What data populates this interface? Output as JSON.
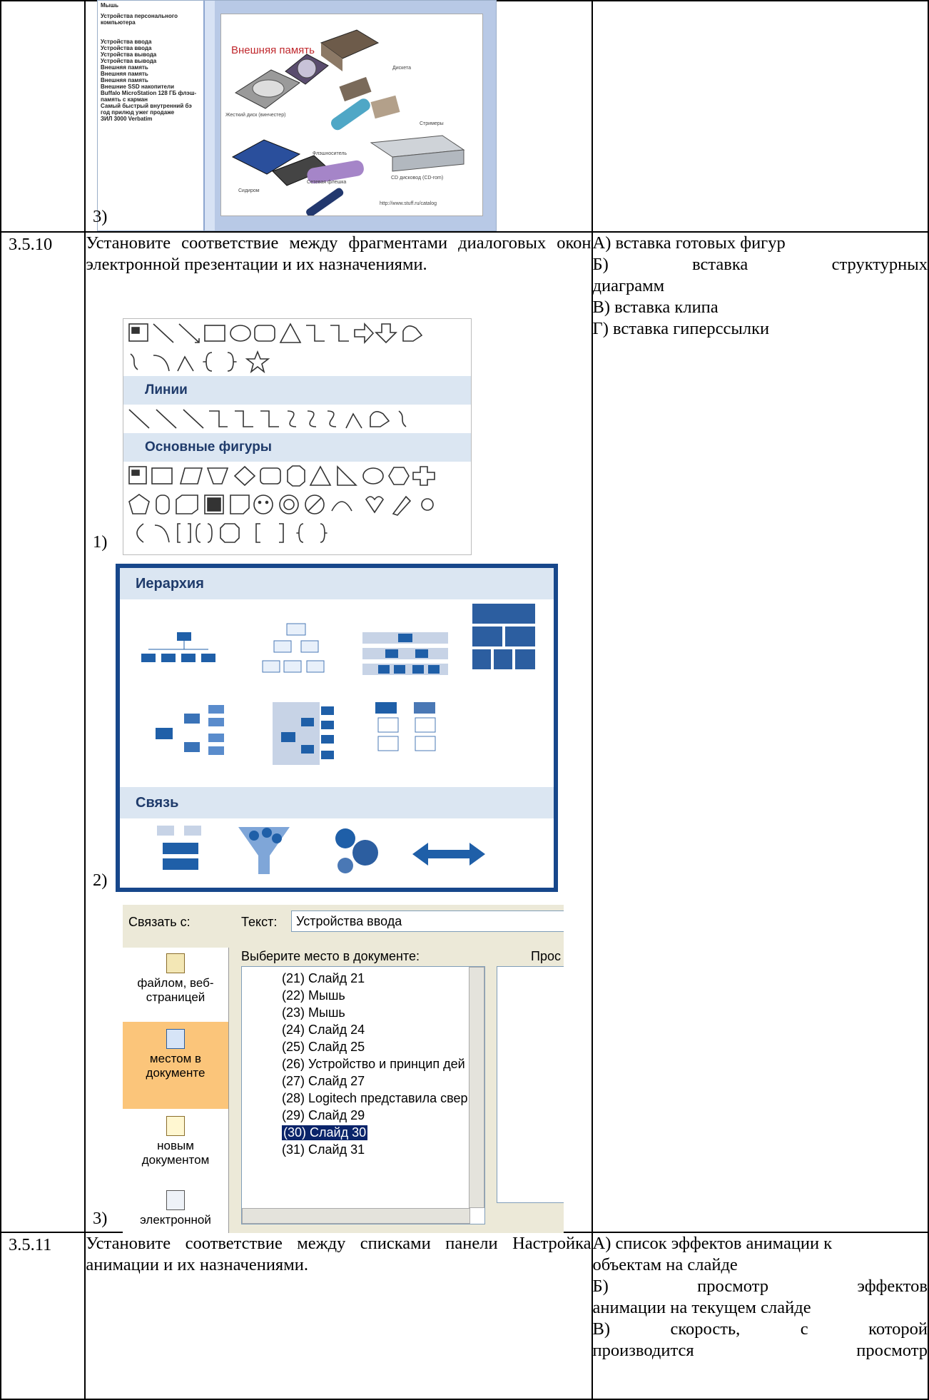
{
  "row_prev": {
    "marker": "3)",
    "slide": {
      "title": "Внешняя память",
      "captions": [
        "Жесткий диск (винчестер)",
        "Дискета",
        "Стримеры",
        "CD дисковод (CD-rom)",
        "Сидиром",
        "Сетевая флешка",
        "Флэшноситель",
        "http://www.stuff.ru/catalog"
      ],
      "outline": [
        "Мышь",
        "Устройства персонального компьютера",
        "Устройства ввода",
        "Устройства ввода",
        "Устройства вывода",
        "Устройства вывода",
        "Внешняя память",
        "Внешняя память",
        "Внешняя память",
        "Внешние SSD накопители",
        "Buffalo MicroStation 128 ГБ флэш-память с карман",
        "Самый быстрый внутренний бэ год прилюд ужег продаже",
        "ЗИЛ 3000 Verbatim"
      ]
    }
  },
  "row_3510": {
    "number": "3.5.10",
    "question": "Установите соответствие между фрагментами диалоговых окон электронной презентации и их назначениями.",
    "markers": [
      "1)",
      "2)",
      "3)"
    ],
    "answers": {
      "a": "А) вставка готовых фигур",
      "b1": "Б) вставка структурных",
      "b2": "диаграмм",
      "c": "В) вставка клипа",
      "d": "Г) вставка гиперссылки"
    },
    "shapes_dialog": {
      "lines_header": "Линии",
      "basic_header": "Основные фигуры"
    },
    "smartart_dialog": {
      "hierarchy_header": "Иерархия",
      "relation_header": "Связь"
    },
    "link_dialog": {
      "link_to_label": "Связать с:",
      "text_label": "Текст:",
      "text_value": "Устройства ввода",
      "place_label": "Выберите место в документе:",
      "preview_label": "Прос",
      "side_items": [
        {
          "line1": "файлом, веб-",
          "line2": "страницей"
        },
        {
          "line1": "местом в",
          "line2": "документе"
        },
        {
          "line1": "новым",
          "line2": "документом"
        },
        {
          "line1": "электронной",
          "line2": ""
        }
      ],
      "tree_items": [
        "(21) Слайд 21",
        "(22) Мышь",
        "(23) Мышь",
        "(24) Слайд 24",
        "(25) Слайд 25",
        "(26) Устройство и принцип дей",
        "(27) Слайд 27",
        "(28) Logitech представила свер",
        "(29) Слайд 29",
        "(30) Слайд 30",
        "(31) Слайд 31"
      ],
      "selected_item": "(30) Слайд 30"
    }
  },
  "row_3511": {
    "number": "3.5.11",
    "question": "Установите соответствие между списками панели Настройка анимации и их назначениями.",
    "answers": {
      "a1": "А) список эффектов анимации к",
      "a2": "объектам на слайде",
      "b1": "Б) просмотр эффектов",
      "b2": "анимации на текущем слайде",
      "c1": "В) скорость, с которой",
      "c2": "производится просмотр"
    }
  }
}
